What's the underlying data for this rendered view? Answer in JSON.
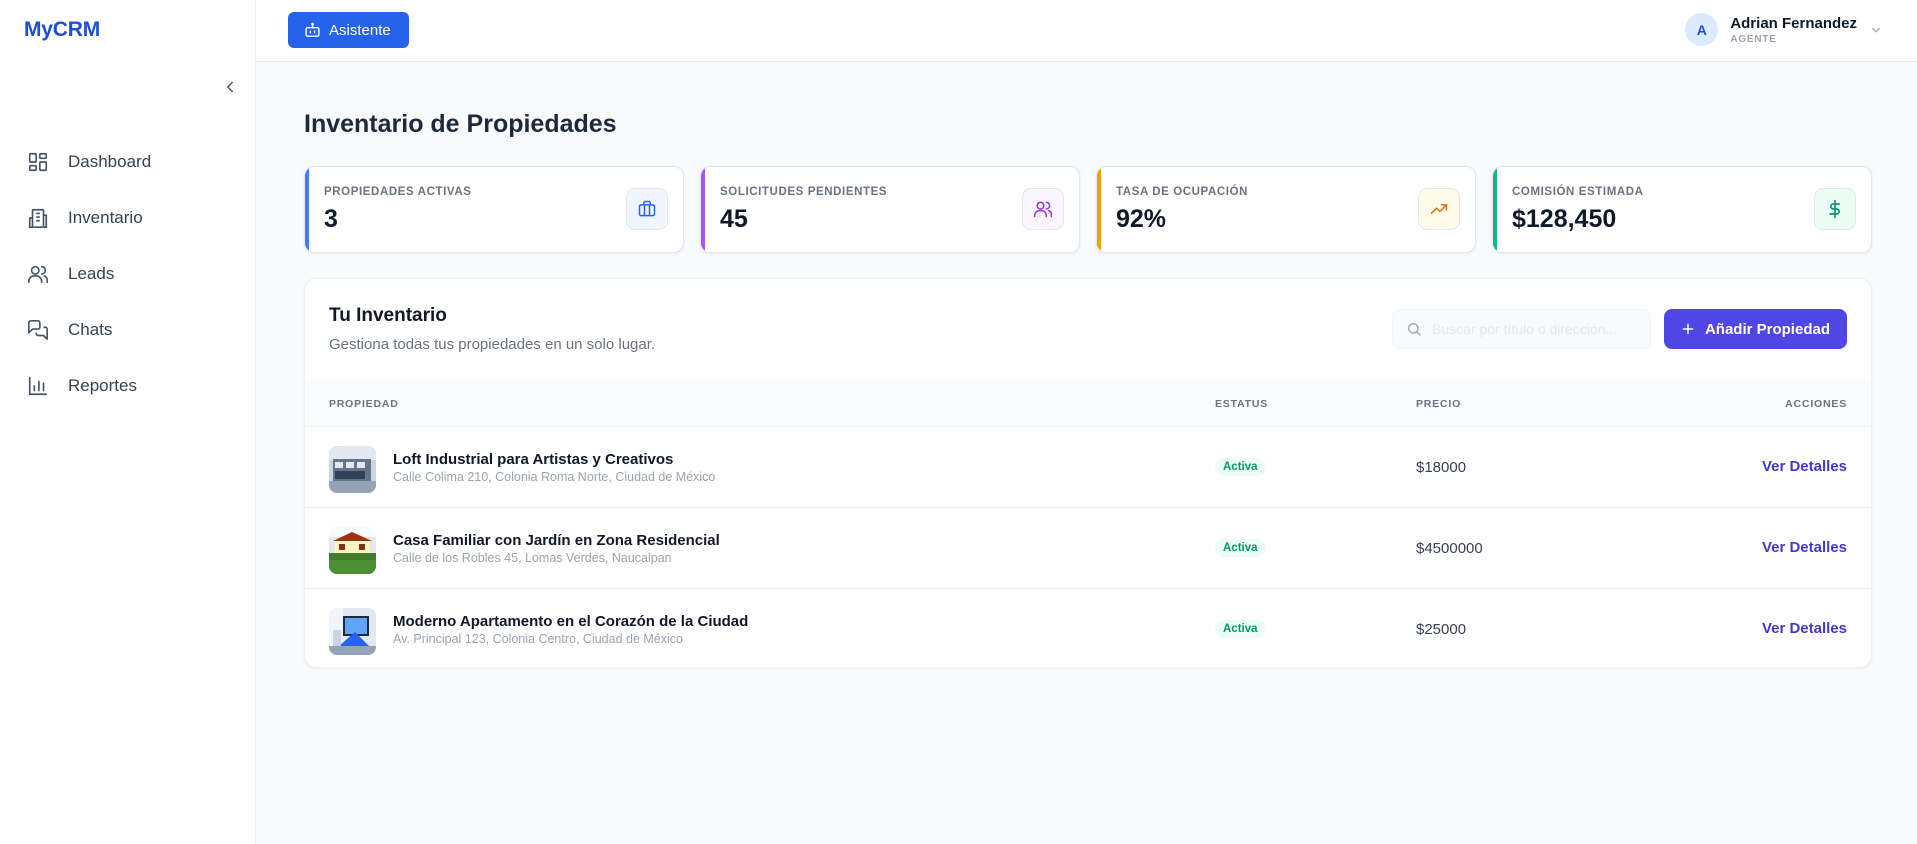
{
  "brand": "MyCRM",
  "sidebar": {
    "items": [
      {
        "label": "Dashboard",
        "icon": "dashboard-icon"
      },
      {
        "label": "Inventario",
        "icon": "building-icon"
      },
      {
        "label": "Leads",
        "icon": "users-icon"
      },
      {
        "label": "Chats",
        "icon": "chat-icon"
      },
      {
        "label": "Reportes",
        "icon": "bar-chart-icon"
      }
    ]
  },
  "header": {
    "assistant_label": "Asistente",
    "user": {
      "initial": "A",
      "name": "Adrian Fernandez",
      "role": "AGENTE"
    }
  },
  "page_title": "Inventario de Propiedades",
  "stats": [
    {
      "label": "PROPIEDADES ACTIVAS",
      "value": "3",
      "color": "#3b82f6",
      "icon": "briefcase-icon"
    },
    {
      "label": "SOLICITUDES PENDIENTES",
      "value": "45",
      "color": "#a855f7",
      "icon": "users-icon"
    },
    {
      "label": "TASA DE OCUPACIÓN",
      "value": "92%",
      "color": "#f59e0b",
      "icon": "trending-up-icon"
    },
    {
      "label": "COMISIÓN ESTIMADA",
      "value": "$128,450",
      "color": "#10b981",
      "icon": "dollar-icon"
    }
  ],
  "inventory": {
    "title": "Tu Inventario",
    "subtitle": "Gestiona todas tus propiedades en un solo lugar.",
    "search_placeholder": "Buscar por título o dirección...",
    "add_label": "Añadir Propiedad",
    "columns": {
      "property": "PROPIEDAD",
      "status": "ESTATUS",
      "price": "PRECIO",
      "actions": "ACCIONES"
    },
    "rows": [
      {
        "title": "Loft Industrial para Artistas y Creativos",
        "address": "Calle Colima 210, Colonia Roma Norte, Ciudad de México",
        "status": "Activa",
        "price": "$18000",
        "action": "Ver Detalles"
      },
      {
        "title": "Casa Familiar con Jardín en Zona Residencial",
        "address": "Calle de los Robles 45, Lomas Verdes, Naucalpan",
        "status": "Activa",
        "price": "$4500000",
        "action": "Ver Detalles"
      },
      {
        "title": "Moderno Apartamento en el Corazón de la Ciudad",
        "address": "Av. Principal 123, Colonia Centro, Ciudad de México",
        "status": "Activa",
        "price": "$25000",
        "action": "Ver Detalles"
      }
    ]
  },
  "colors": {
    "primary": "#2563eb",
    "accent": "#4f46e5",
    "status_active": "#059669"
  }
}
